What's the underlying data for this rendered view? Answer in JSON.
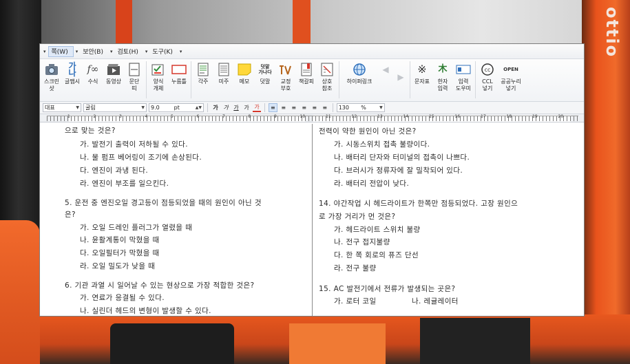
{
  "background": {
    "brand_text": "ottio"
  },
  "menubar": {
    "menus": [
      {
        "label": "쪽(W)"
      },
      {
        "label": "보안(B)"
      },
      {
        "label": "검토(H)"
      },
      {
        "label": "도구(K)"
      }
    ]
  },
  "ribbon": {
    "groups": [
      [
        {
          "icon": "camera-icon",
          "label": "스크린\n샷"
        },
        {
          "icon": "glyph-art-icon",
          "label": "글맵시"
        },
        {
          "icon": "formula-icon",
          "label": "수식"
        },
        {
          "icon": "video-icon",
          "label": "동영상"
        },
        {
          "icon": "column-icon",
          "label": "문단\n띠"
        }
      ],
      [
        {
          "icon": "form-object-icon",
          "label": "양식\n개체"
        },
        {
          "icon": "push-button-icon",
          "label": "누름틀"
        }
      ],
      [
        {
          "icon": "footnote-icon",
          "label": "각주"
        },
        {
          "icon": "endnote-icon",
          "label": "미주"
        },
        {
          "icon": "memo-icon",
          "label": "메모"
        },
        {
          "icon": "dot-text-icon",
          "label": "덧말"
        },
        {
          "icon": "proof-mark-icon",
          "label": "교정\n부호"
        },
        {
          "icon": "bookmark-icon",
          "label": "책갈피"
        },
        {
          "icon": "cross-ref-icon",
          "label": "상호\n참조"
        }
      ],
      [
        {
          "icon": "hyperlink-icon",
          "label": "하이퍼링크"
        },
        {
          "icon": "arrow-left-icon",
          "label": ""
        },
        {
          "icon": "arrow-right-icon",
          "label": ""
        }
      ],
      [
        {
          "icon": "symbol-icon",
          "label": "문자표"
        },
        {
          "icon": "hanja-icon",
          "label": "한자\n입력"
        },
        {
          "icon": "input-domain-icon",
          "label": "입력\n도우미"
        }
      ],
      [
        {
          "icon": "ccl-icon",
          "label": "CCL\n넣기"
        },
        {
          "icon": "open-license-icon",
          "label": "공공누리\n넣기"
        }
      ]
    ],
    "glyph_art_text": "가나",
    "formula_text": "f∞",
    "dot_text_text": "덧말\n가나다",
    "open_text": "OPEN"
  },
  "formatbar": {
    "style": "대표",
    "font": "굴림",
    "size": "9.0",
    "size_unit": "pt",
    "bold": "가",
    "italic": "가",
    "underline": "가",
    "strike": "가",
    "color": "가",
    "line_spacing": "130",
    "line_spacing_unit": "%"
  },
  "ruler": {
    "numbers": [
      "1",
      "2",
      "3",
      "4",
      "5",
      "6",
      "7",
      "8",
      "9",
      "10",
      "11",
      "12",
      "13",
      "14",
      "15",
      "16",
      "17",
      "18",
      "19",
      "20"
    ]
  },
  "document": {
    "left": [
      {
        "text": "으로 맞는 것은?",
        "indent": false
      },
      {
        "text": "가. 발전기 출력이 저하될 수 있다.",
        "indent": true
      },
      {
        "text": "나. 물 펌프 베어링이 조기에 손상된다.",
        "indent": true
      },
      {
        "text": "다. 엔진이 과냉 된다.",
        "indent": true
      },
      {
        "text": "라. 엔진이 부조를 일으킨다.",
        "indent": true
      },
      {
        "text": "5. 운전 중 엔진오일 경고등이 점등되었을 때의 원인이 아닌 것",
        "indent": false
      },
      {
        "text": "은?",
        "indent": false
      },
      {
        "text": "가. 오일 드레인 플러그가 열렸을 때",
        "indent": true
      },
      {
        "text": "나. 윤활계통이 막혔을 때",
        "indent": true
      },
      {
        "text": "다. 오일필터가 막혔을 때",
        "indent": true
      },
      {
        "text": "라. 오일 밀도가 낮을 때",
        "indent": true
      },
      {
        "text": "6. 기관 과열 시 일어날 수 있는 현상으로 가장 적합한 것은?",
        "indent": false
      },
      {
        "text": "가. 연료가 응결될 수 있다.",
        "indent": true
      },
      {
        "text": "나. 실린더 헤드의 변형이 발생할 수 있다.",
        "indent": true
      }
    ],
    "right": [
      {
        "text": "전력이 약한 원인이 아닌 것은?",
        "indent": false
      },
      {
        "text": "가. 시동스위치 접촉 불량이다.",
        "indent": true
      },
      {
        "text": "나. 배터리 단자와 터미널의 접촉이 나쁘다.",
        "indent": true
      },
      {
        "text": "다. 브러시가 정류자에 잘 밀착되어 있다.",
        "indent": true
      },
      {
        "text": "라. 배터리 전압이 낮다.",
        "indent": true
      },
      {
        "text": "14. 야간작업 시 헤드라이트가 한쪽만 점등되었다. 고장 원인으",
        "indent": false
      },
      {
        "text": "로 가장 거리가 먼 것은?",
        "indent": false
      },
      {
        "text": "가. 헤드라이트 스위치 불량",
        "indent": true
      },
      {
        "text": "나. 전구 접지불량",
        "indent": true
      },
      {
        "text": "다. 한 쪽 회로의 퓨즈 단선",
        "indent": true
      },
      {
        "text": "라. 전구 불량",
        "indent": true
      },
      {
        "text": "15. AC 발전기에서 전류가 발생되는 곳은?",
        "indent": false
      },
      {
        "text": "가. 로터 코일",
        "indent": true
      },
      {
        "text": "나. 레귤레이터",
        "indent": true
      }
    ]
  },
  "colors": {
    "ribbon_accent": "#2f6fba",
    "text": "#2b2b2b",
    "window_bg": "#ffffff"
  }
}
